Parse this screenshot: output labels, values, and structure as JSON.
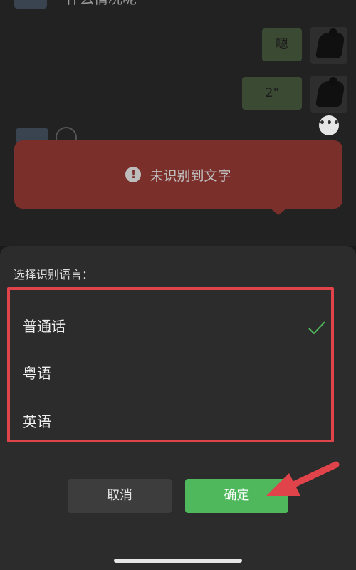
{
  "chat": {
    "top_text": "什么情况呢",
    "messages": [
      {
        "side": "right",
        "text": "嗯"
      },
      {
        "side": "right",
        "text": "2\""
      }
    ]
  },
  "toast": {
    "icon": "warning-icon",
    "text": "未识别到文字"
  },
  "sheet": {
    "title": "选择识别语言：",
    "options": [
      {
        "label": "普通话",
        "selected": true
      },
      {
        "label": "粤语",
        "selected": false
      },
      {
        "label": "英语",
        "selected": false
      }
    ],
    "cancel_label": "取消",
    "confirm_label": "确定"
  },
  "colors": {
    "toast_bg": "#7a2f2b",
    "highlight_border": "#e0434a",
    "confirm_green": "#4fb85c",
    "check_green": "#4fb85c",
    "annotation_arrow": "#e0434a"
  }
}
